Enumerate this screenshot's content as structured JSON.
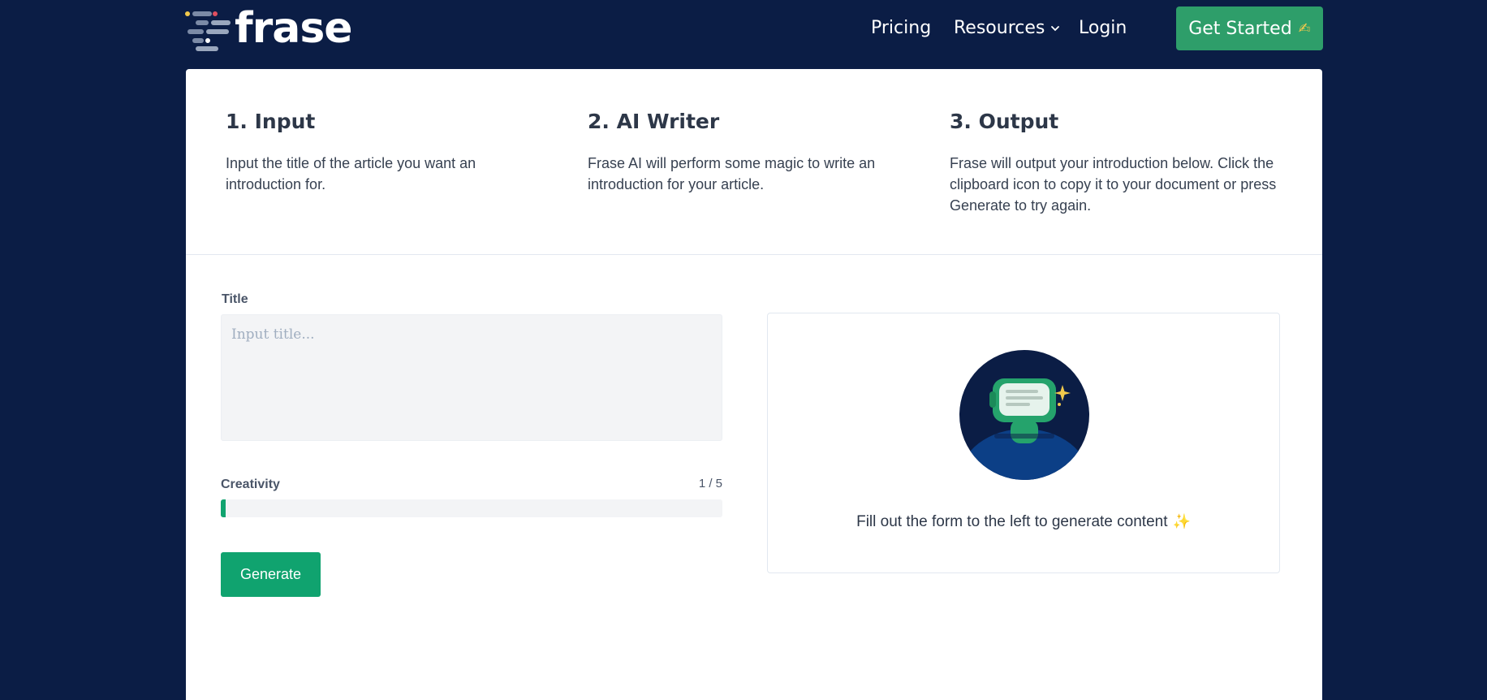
{
  "header": {
    "brand": "frase",
    "nav": {
      "pricing": "Pricing",
      "resources": "Resources",
      "login": "Login"
    },
    "cta_label": "Get Started",
    "cta_emoji": "✍"
  },
  "steps": [
    {
      "title": "1. Input",
      "text": "Input the title of the article you want an introduction for."
    },
    {
      "title": "2. AI Writer",
      "text": "Frase AI will perform some magic to write an introduction for your article."
    },
    {
      "title": "3. Output",
      "text": "Frase will output your introduction below. Click the clipboard icon to copy it to your document or press Generate to try again."
    }
  ],
  "form": {
    "title_label": "Title",
    "title_placeholder": "Input title...",
    "title_value": "",
    "creativity_label": "Creativity",
    "creativity_display": "1 / 5",
    "creativity_level": 1,
    "creativity_max": 5,
    "generate_label": "Generate"
  },
  "output": {
    "message": "Fill out the form to the left to generate content",
    "message_icon": "sparkles-icon",
    "illustration_icon": "robot-icon"
  },
  "colors": {
    "page_background": "#0b1d45",
    "accent_green": "#10a36f",
    "cta_green": "#2e9e6a"
  }
}
